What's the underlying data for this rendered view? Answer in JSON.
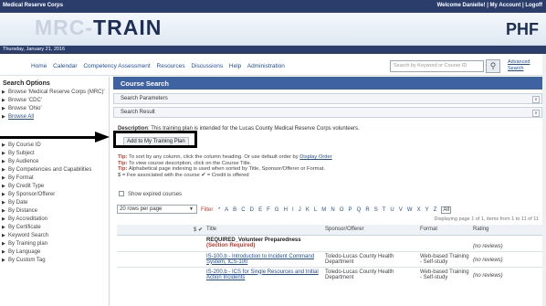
{
  "header": {
    "org": "Medical Reserve Corps",
    "welcome": "Welcome Danielle! | My Account | Logoff",
    "logo_left": "MRC-",
    "logo_right": "TRAIN",
    "partner_logo": "PHF",
    "date": "Thursday, January 21, 2016"
  },
  "nav": {
    "links": [
      "Home",
      "Calendar",
      "Competency Assessment",
      "Resources",
      "Discussions",
      "Help",
      "Administration"
    ],
    "search_placeholder": "Search by Keyword or Course ID",
    "search_icon": "magnifier-icon",
    "advanced": "Advanced Search"
  },
  "sidebar": {
    "title": "Search Options",
    "browse_items": [
      "Browse 'Medical Reserve Corps (MRC)'",
      "Browse 'CDC'",
      "Browse 'Ohio'",
      "Browse All"
    ],
    "by_items": [
      "By Course ID",
      "By Subject",
      "By Audience",
      "By Competencies and Capabilities",
      "By Format",
      "By Credit Type",
      "By Sponsor/Offerer",
      "By Date",
      "By Distance",
      "By Accreditation",
      "By Certificate",
      "Keyword Search",
      "By Training plan",
      "By Language",
      "By Custom Tag"
    ]
  },
  "main": {
    "title": "Course Search",
    "search_parameters": "Search Parameters",
    "search_result": "Search Result",
    "description_label": "Description",
    "description_text": ":  This training plan is intended for the Lucas County Medical Reserve Corps volunteers.",
    "add_button": "Add to My Training Plan",
    "tips": [
      {
        "label": "Tip:",
        "text": " To sort by any column, click the column heading. Or use default order by ",
        "link": "Display Order"
      },
      {
        "label": "Tip:",
        "text": " To view course description, click on the Course Title.",
        "link": ""
      },
      {
        "label": "Tip:",
        "text": " Alphabetical page indexing is used when sorted by Title, Sponsor/Offerer or Format.",
        "link": ""
      }
    ],
    "legend": "$ = Fee associated with the course    ✔ = Credit is offered",
    "show_expired": "Show expired courses",
    "rows_per_page": "20 rows per page",
    "filter_label": "Filter",
    "filter_letters": [
      "*",
      "A",
      "B",
      "C",
      "D",
      "E",
      "F",
      "G",
      "H",
      "I",
      "J",
      "K",
      "L",
      "M",
      "N",
      "O",
      "P",
      "Q",
      "R",
      "S",
      "T",
      "U",
      "V",
      "W",
      "X",
      "Y",
      "Z"
    ],
    "filter_all": "All",
    "display_info": "Displaying page 1 of 1, items from 1 to 11 of 11",
    "columns": [
      "$  ✔",
      "Title",
      "Sponsor/Offerer",
      "Format",
      "Rating"
    ],
    "required_title": "REQUIRED_Volunteer Preparedness",
    "required_sub": "(Section Required)",
    "required_rating": "(no reviews)",
    "rows": [
      {
        "title": "IS-100.b - Introduction to Incident Command System, ICS-100",
        "sponsor": "Toledo-Lucas County Health Department",
        "format": "Web-based Training - Self-study",
        "rating": "(no reviews)"
      },
      {
        "title": "IS-200.b - ICS for Single Resources and Initial Action Incidents",
        "sponsor": "Toledo-Lucas County Health Department",
        "format": "Web-based Training - Self-study",
        "rating": "(no reviews)"
      }
    ]
  }
}
